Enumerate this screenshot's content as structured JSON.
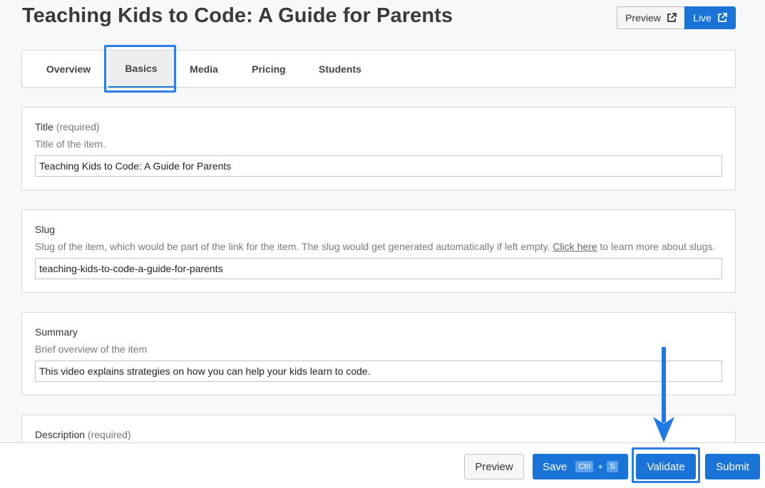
{
  "page": {
    "title": "Teaching Kids to Code: A Guide for Parents"
  },
  "top_actions": {
    "preview_label": "Preview",
    "live_label": "Live",
    "link_icon": "external-link-icon"
  },
  "tabs": [
    {
      "label": "Overview",
      "active": false
    },
    {
      "label": "Basics",
      "active": true
    },
    {
      "label": "Media",
      "active": false
    },
    {
      "label": "Pricing",
      "active": false
    },
    {
      "label": "Students",
      "active": false
    }
  ],
  "fields": {
    "title": {
      "label": "Title",
      "required": "(required)",
      "help": "Title of the item.",
      "value": "Teaching Kids to Code: A Guide for Parents"
    },
    "slug": {
      "label": "Slug",
      "help_before": "Slug of the item, which would be part of the link for the item. The slug would get generated automatically if left empty.",
      "help_link": "Click here",
      "help_after": " to learn more about slugs.",
      "value": "teaching-kids-to-code-a-guide-for-parents"
    },
    "summary": {
      "label": "Summary",
      "help": "Brief overview of the item",
      "value": "This video explains strategies on how you can help your kids learn to code."
    },
    "description": {
      "label": "Description",
      "required": "(required)"
    }
  },
  "bottom_bar": {
    "preview_label": "Preview",
    "save_label": "Save",
    "save_shortcut_key1": "Ctrl",
    "save_shortcut_plus": "+",
    "save_shortcut_key2": "S",
    "validate_label": "Validate",
    "submit_label": "Submit"
  },
  "colors": {
    "accent": "#1a73d6",
    "highlight": "#2f7de8"
  }
}
